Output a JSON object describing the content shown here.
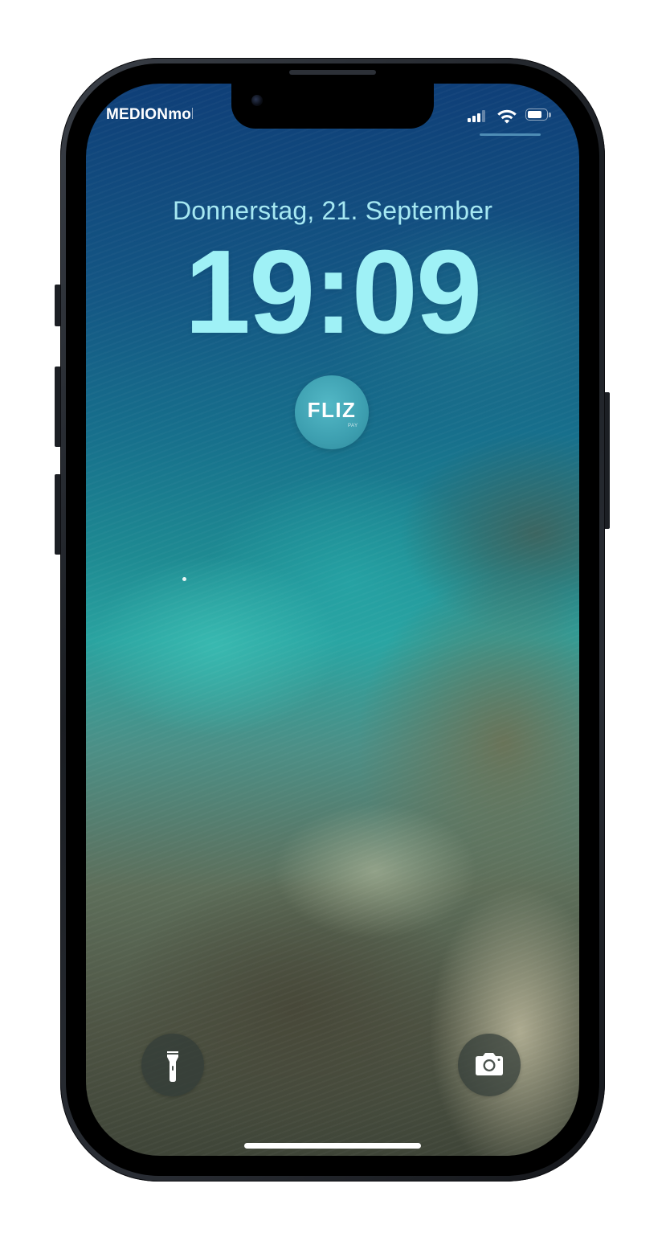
{
  "status_bar": {
    "carrier": "MEDIONmobile",
    "battery_level": 0.75,
    "signal_bars": 3
  },
  "lock_screen": {
    "date": "Donnerstag, 21. September",
    "time": "19:09"
  },
  "widget": {
    "logo": "FLIZ",
    "sublabel": "PAY"
  },
  "quick_actions": {
    "flashlight_icon": "flashlight-icon",
    "camera_icon": "camera-icon"
  },
  "colors": {
    "clock": "#9ff1f6",
    "date": "#a6e8f2",
    "widget": "#3d9fb0"
  }
}
